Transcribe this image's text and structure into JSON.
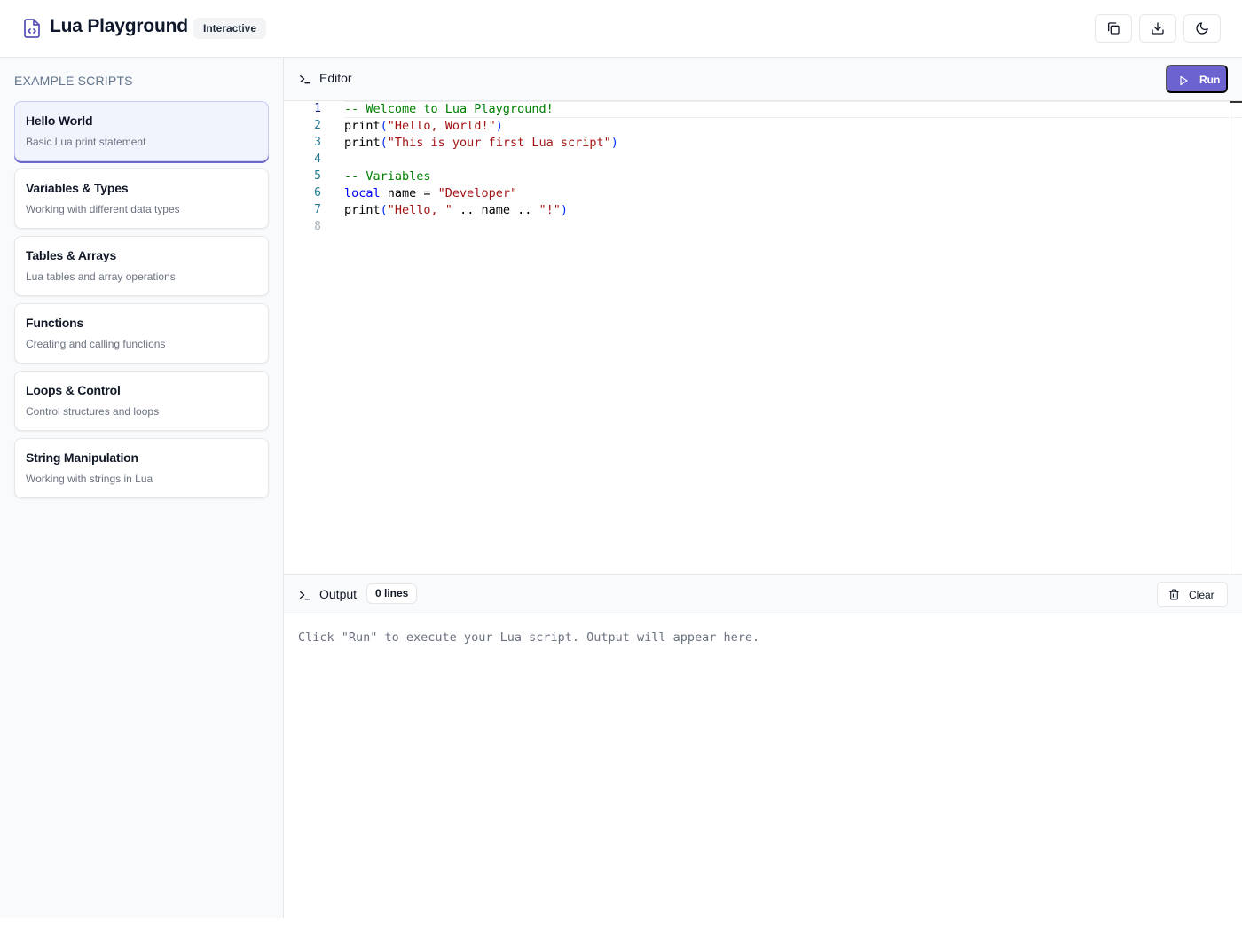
{
  "header": {
    "title": "Lua Playground",
    "badge": "Interactive",
    "logo_icon": "file-code-icon",
    "buttons": [
      {
        "icon": "copy-icon"
      },
      {
        "icon": "download-icon"
      },
      {
        "icon": "moon-icon"
      }
    ]
  },
  "sidebar": {
    "heading": "EXAMPLE SCRIPTS",
    "scripts": [
      {
        "title": "Hello World",
        "description": "Basic Lua print statement",
        "active": true
      },
      {
        "title": "Variables & Types",
        "description": "Working with different data types",
        "active": false
      },
      {
        "title": "Tables & Arrays",
        "description": "Lua tables and array operations",
        "active": false
      },
      {
        "title": "Functions",
        "description": "Creating and calling functions",
        "active": false
      },
      {
        "title": "Loops & Control",
        "description": "Control structures and loops",
        "active": false
      },
      {
        "title": "String Manipulation",
        "description": "Working with strings in Lua",
        "active": false
      }
    ]
  },
  "editor": {
    "title": "Editor",
    "run_label": "Run",
    "line_numbers": [
      "1",
      "2",
      "3",
      "4",
      "5",
      "6",
      "7",
      "8"
    ],
    "lines": {
      "l1_comment": "-- Welcome to Lua Playground!",
      "l2_fn": "print",
      "l2_open": "(",
      "l2_str": "\"Hello, World!\"",
      "l2_close": ")",
      "l3_fn": "print",
      "l3_open": "(",
      "l3_str": "\"This is your first Lua script\"",
      "l3_close": ")",
      "l5_comment": "-- Variables",
      "l6_kw": "local",
      "l6_mid": " name = ",
      "l6_str": "\"Developer\"",
      "l7_fn": "print",
      "l7_open": "(",
      "l7_str1": "\"Hello, \"",
      "l7_mid": " .. name .. ",
      "l7_str2": "\"!\"",
      "l7_close": ")"
    },
    "colors": {
      "comment": "#008000",
      "string": "#a31515",
      "keyword": "#0000ff",
      "accent": "#6d63d0"
    }
  },
  "output": {
    "title": "Output",
    "count": "0 lines",
    "clear_label": "Clear",
    "placeholder": "Click \"Run\" to execute your Lua script. Output will appear here."
  }
}
